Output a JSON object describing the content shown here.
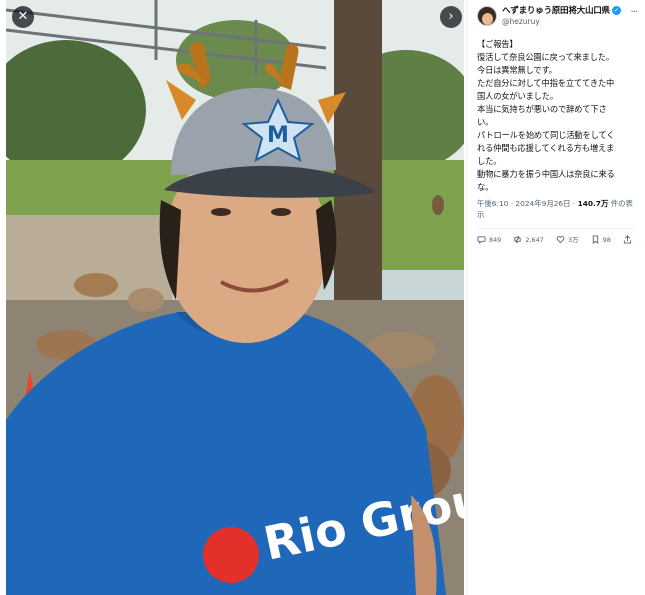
{
  "viewer": {
    "close_icon": "close-icon",
    "next_icon": "chevron-right-icon"
  },
  "photo": {
    "cap_logo": "M",
    "shirt_text": "Rio Grou",
    "colors": {
      "shirt": "#1f67b8",
      "cap": "#9aa2ab",
      "grass": "#7ea24d"
    }
  },
  "tweet": {
    "display_name": "へずまりゅう原田将大山口県",
    "handle": "@hezuruy",
    "lines": [
      "【ご報告】",
      "復活して奈良公園に戻って来ました。",
      "今日は異常無しです。",
      "ただ自分に対して中指を立ててきた中",
      "国人の女がいました。",
      "本当に気持ちが悪いので辞めて下さ",
      "い。",
      "パトロールを始めて同じ活動をしてく",
      "れる仲間も応援してくれる方も増えま",
      "した。",
      "動物に暴力を振う中国人は奈良に来る",
      "な。"
    ],
    "time": "午後6:10 · 2024年9月26日 · ",
    "views_count": "140.7万",
    "views_label": " 件の表",
    "views_label_cont": "示",
    "replies": "849",
    "retweets": "2,647",
    "likes": "3万",
    "bookmarks": "98"
  }
}
